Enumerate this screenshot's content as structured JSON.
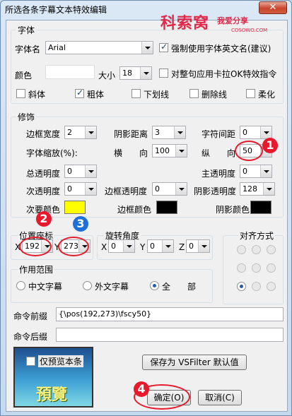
{
  "window": {
    "title": "所选各条字幕文本特效编辑",
    "close_label": "✕"
  },
  "watermark": {
    "main": "科索窝",
    "sub": "我爱分享",
    "url": "COSOWO.COM"
  },
  "font_group": {
    "label": "字体",
    "font_name_label": "字体名",
    "font_name_value": "Arial",
    "force_en_name": {
      "label": "强制使用字体英文名(建议)",
      "checked": true
    },
    "color_label": "颜色",
    "size_label": "大小",
    "size_value": "18",
    "apply_karaoke": {
      "label": "对整句应用卡拉OK特效指令",
      "checked": false
    },
    "styles": [
      {
        "label": "斜体",
        "checked": false
      },
      {
        "label": "粗体",
        "checked": true
      },
      {
        "label": "下划线",
        "checked": false
      },
      {
        "label": "删除线",
        "checked": false
      },
      {
        "label": "柔化",
        "checked": false
      }
    ]
  },
  "decoration": {
    "label": "修饰",
    "border_width_label": "边框宽度",
    "border_width": "2",
    "shadow_dist_label": "阴影距离",
    "shadow_dist": "3",
    "char_spacing_label": "字符间距",
    "char_spacing": "0",
    "font_scale_label": "字体缩放(%):",
    "horizontal_label": "横　　向",
    "horizontal": "100",
    "vertical_label": "纵　　向",
    "vertical": "50",
    "total_opacity_label": "总透明度",
    "total_opacity": "0",
    "primary_opacity_label": "主透明度",
    "primary_opacity": "0",
    "secondary_opacity_label": "次透明度",
    "secondary_opacity": "0",
    "border_opacity_label": "边框透明度",
    "border_opacity": "0",
    "shadow_opacity_label": "阴影透明度",
    "shadow_opacity": "128",
    "secondary_color_label": "次要颜色",
    "border_color_label": "边框颜色",
    "shadow_color_label": "阴影颜色",
    "colors": {
      "secondary": "#ffff00",
      "border": "#000000",
      "shadow": "#000000",
      "primary": "#ffffff"
    }
  },
  "position": {
    "label": "位置座标",
    "x_label": "X",
    "x": "192",
    "y_label": "Y",
    "y": "273"
  },
  "rotation": {
    "label": "旋转角度",
    "x_label": "X",
    "x": "0",
    "y_label": "Y",
    "y": "0",
    "z_label": "Z",
    "z": "0"
  },
  "alignment": {
    "label": "对齐方式",
    "selected_index": 6
  },
  "scope": {
    "label": "作用范围",
    "options": [
      {
        "label": "中文字幕",
        "selected": false
      },
      {
        "label": "外文字幕",
        "selected": false
      },
      {
        "label": "全　　部",
        "selected": true
      }
    ]
  },
  "command_prefix": {
    "label": "命令前缀",
    "value": "{\\pos(192,273)\\fscy50}"
  },
  "command_suffix": {
    "label": "命令后缀",
    "value": ""
  },
  "preview": {
    "only_preview_label": "仅预览本条",
    "text": "預覽",
    "checked": false
  },
  "buttons": {
    "save_default": "保存为 VSFilter 默认值",
    "ok": "确定(O)",
    "cancel": "取消(C)"
  },
  "annotations": [
    "1",
    "2",
    "3",
    "4"
  ]
}
